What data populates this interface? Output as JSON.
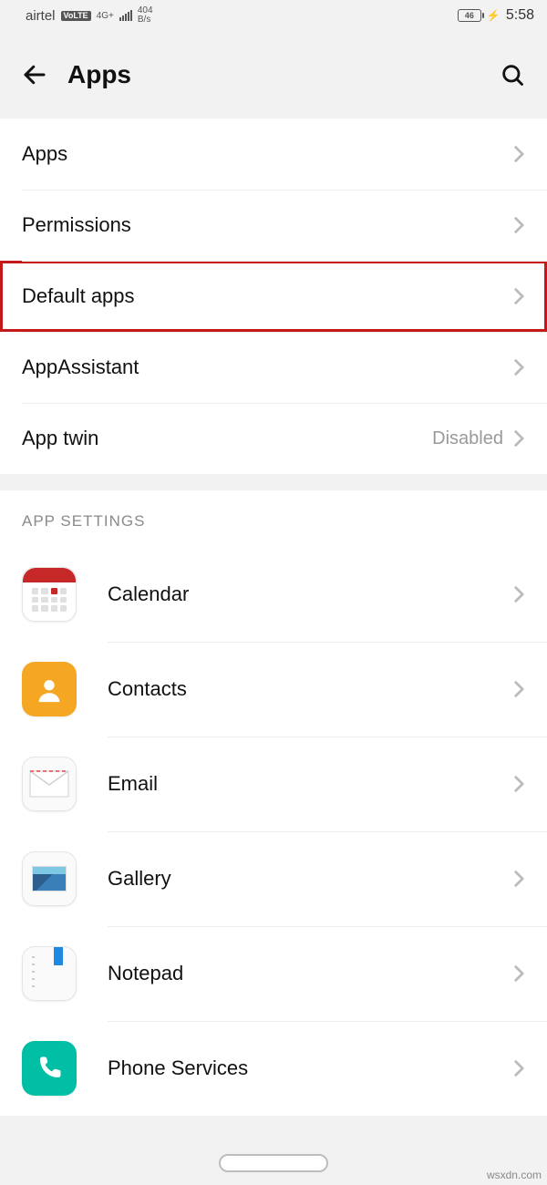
{
  "status": {
    "carrier": "airtel",
    "volte": "VoLTE",
    "net": "4G+",
    "speed_top": "404",
    "speed_bot": "B/s",
    "battery": "46",
    "time": "5:58"
  },
  "header": {
    "title": "Apps"
  },
  "menu": [
    {
      "label": "Apps",
      "value": ""
    },
    {
      "label": "Permissions",
      "value": ""
    },
    {
      "label": "Default apps",
      "value": "",
      "highlight": true
    },
    {
      "label": "AppAssistant",
      "value": ""
    },
    {
      "label": "App twin",
      "value": "Disabled"
    }
  ],
  "section_title": "APP SETTINGS",
  "apps": [
    {
      "label": "Calendar"
    },
    {
      "label": "Contacts"
    },
    {
      "label": "Email"
    },
    {
      "label": "Gallery"
    },
    {
      "label": "Notepad"
    },
    {
      "label": "Phone Services"
    }
  ],
  "watermark": "wsxdn.com"
}
